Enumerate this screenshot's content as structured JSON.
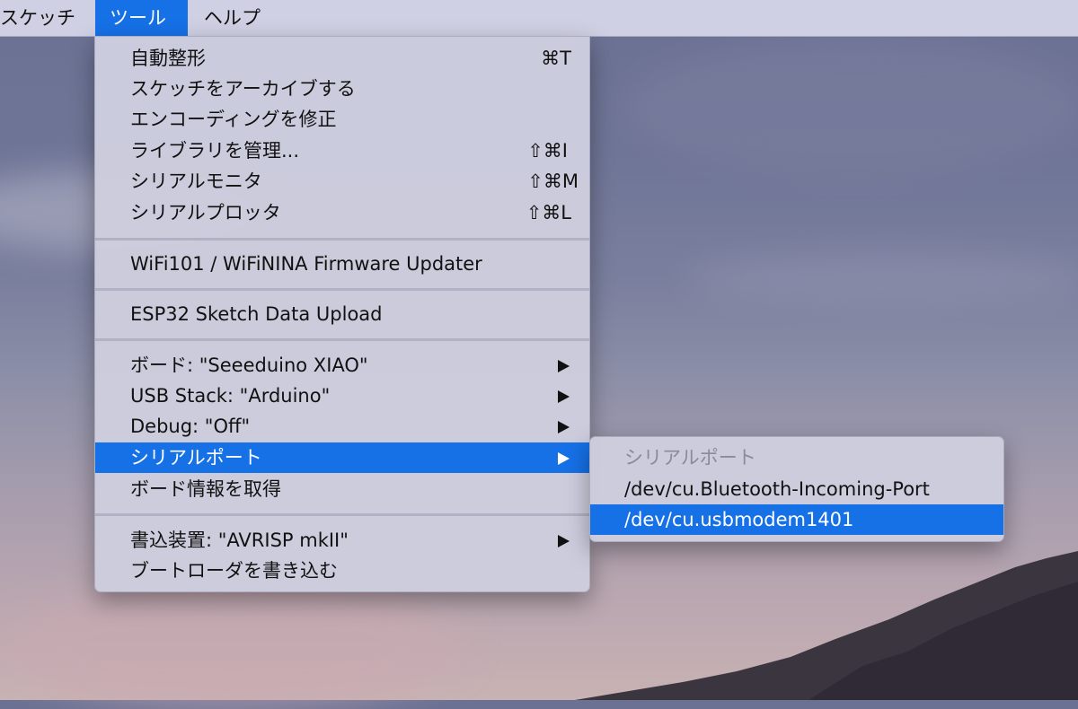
{
  "menubar": {
    "items": [
      {
        "label": "スケッチ"
      },
      {
        "label": "ツール"
      },
      {
        "label": "ヘルプ"
      }
    ]
  },
  "tools_menu": {
    "groups": [
      [
        {
          "label": "自動整形",
          "shortcut": "⌘T"
        },
        {
          "label": "スケッチをアーカイブする",
          "shortcut": ""
        },
        {
          "label": "エンコーディングを修正",
          "shortcut": ""
        },
        {
          "label": "ライブラリを管理...",
          "shortcut": "⇧⌘I"
        },
        {
          "label": "シリアルモニタ",
          "shortcut": "⇧⌘M"
        },
        {
          "label": "シリアルプロッタ",
          "shortcut": "⇧⌘L"
        }
      ],
      [
        {
          "label": "WiFi101 / WiFiNINA Firmware Updater"
        }
      ],
      [
        {
          "label": "ESP32 Sketch Data Upload"
        }
      ],
      [
        {
          "label": "ボード: \"Seeeduino XIAO\"",
          "submenu": true
        },
        {
          "label": "USB Stack: \"Arduino\"",
          "submenu": true
        },
        {
          "label": "Debug: \"Off\"",
          "submenu": true
        },
        {
          "label": "シリアルポート",
          "submenu": true,
          "highlighted": true
        },
        {
          "label": "ボード情報を取得"
        }
      ],
      [
        {
          "label": "書込装置: \"AVRISP mkII\"",
          "submenu": true
        },
        {
          "label": "ブートローダを書き込む"
        }
      ]
    ]
  },
  "port_menu": {
    "header": "シリアルポート",
    "ports": [
      {
        "label": "/dev/cu.Bluetooth-Incoming-Port",
        "highlighted": false
      },
      {
        "label": "/dev/cu.usbmodem1401",
        "highlighted": true
      }
    ]
  }
}
